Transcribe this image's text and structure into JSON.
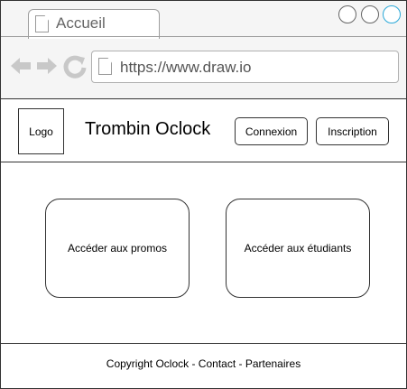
{
  "browser": {
    "tab_title": "Accueil",
    "url": "https://www.draw.io",
    "window_buttons": [
      "minimize",
      "maximize",
      "close"
    ],
    "nav_icons": [
      "back-arrow-icon",
      "forward-arrow-icon",
      "reload-icon"
    ],
    "accent_color": "#2aa8d8"
  },
  "header": {
    "logo_label": "Logo",
    "site_title": "Trombin Oclock",
    "login_label": "Connexion",
    "signup_label": "Inscription"
  },
  "main": {
    "promos_label": "Accéder aux promos",
    "students_label": "Accéder aux étudiants"
  },
  "footer": {
    "text": "Copyright Oclock - Contact - Partenaires"
  }
}
